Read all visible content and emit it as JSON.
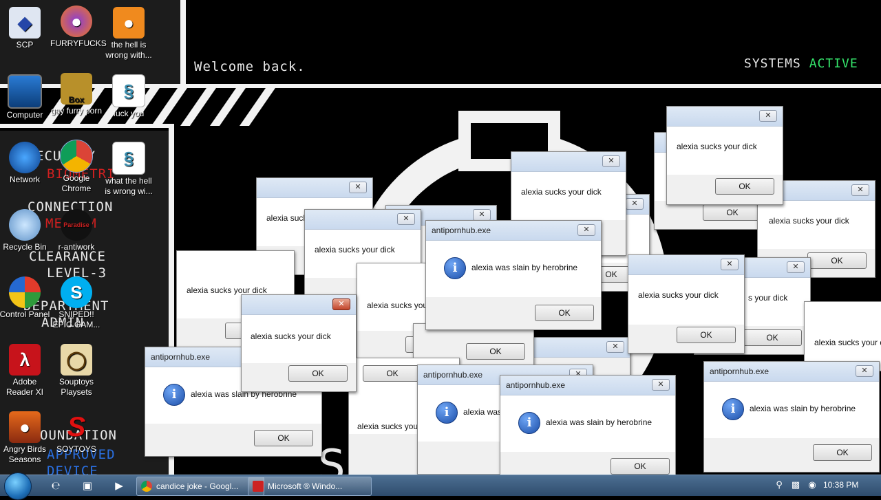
{
  "wallpaper": {
    "welcome": "Welcome back.",
    "systems_label": "SYSTEMS",
    "systems_status": "ACTIVE",
    "left_labels": [
      "ECURITY",
      "BIOMETRI",
      "CONNECTION",
      "MEDIUM",
      "CLEARANCE",
      "LEVEL-3",
      "DEPARTMENT",
      "ADMIN",
      "OUNDATION",
      "APPROVED",
      "DEVICE"
    ],
    "big_text": "Se     ct"
  },
  "desktop_icons": [
    {
      "label": "SCP"
    },
    {
      "label": "FURRYFUCKS"
    },
    {
      "label": "the hell is wrong with..."
    },
    {
      "label": "Computer"
    },
    {
      "label": "gay furry porn"
    },
    {
      "label": "fuck you"
    },
    {
      "label": "Network"
    },
    {
      "label": "Google Chrome"
    },
    {
      "label": "what the hell is wrong wi..."
    },
    {
      "label": "Recycle Bin"
    },
    {
      "label": "r-antiwork"
    },
    {
      "label": "Control Panel"
    },
    {
      "label": "SNIPED!! EPIC GAM..."
    },
    {
      "label": "Adobe Reader XI"
    },
    {
      "label": "Souptoys Playsets"
    },
    {
      "label": "Angry Birds Seasons"
    },
    {
      "label": "SOYTOYS"
    }
  ],
  "icon_glyphs": {
    "box_text": "Box",
    "paradise_text": "Paradise"
  },
  "dialogs": {
    "title": "antipornhub.exe",
    "msg_dick": "alexia sucks your dick",
    "msg_dick_cut1": "alexia suck",
    "msg_dick_cut2": "alexia sucks you",
    "msg_dick_cut3": "alexia sucks your",
    "msg_dick_cut4": "alexia sucks your d",
    "msg_dick_cut5": "s your dick",
    "msg_slain": "alexia was slain by herobrine",
    "msg_slain_cut": "alexia was",
    "ok": "OK",
    "close": "✕",
    "info": "i"
  },
  "taskbar": {
    "tasks": [
      "candice joke - Googl...",
      "Microsoft ® Windo..."
    ],
    "clock": "10:38 PM"
  },
  "colors": {
    "active": "#35e56b",
    "red_label": "#d02020",
    "blue_label": "#2a6fe0"
  }
}
